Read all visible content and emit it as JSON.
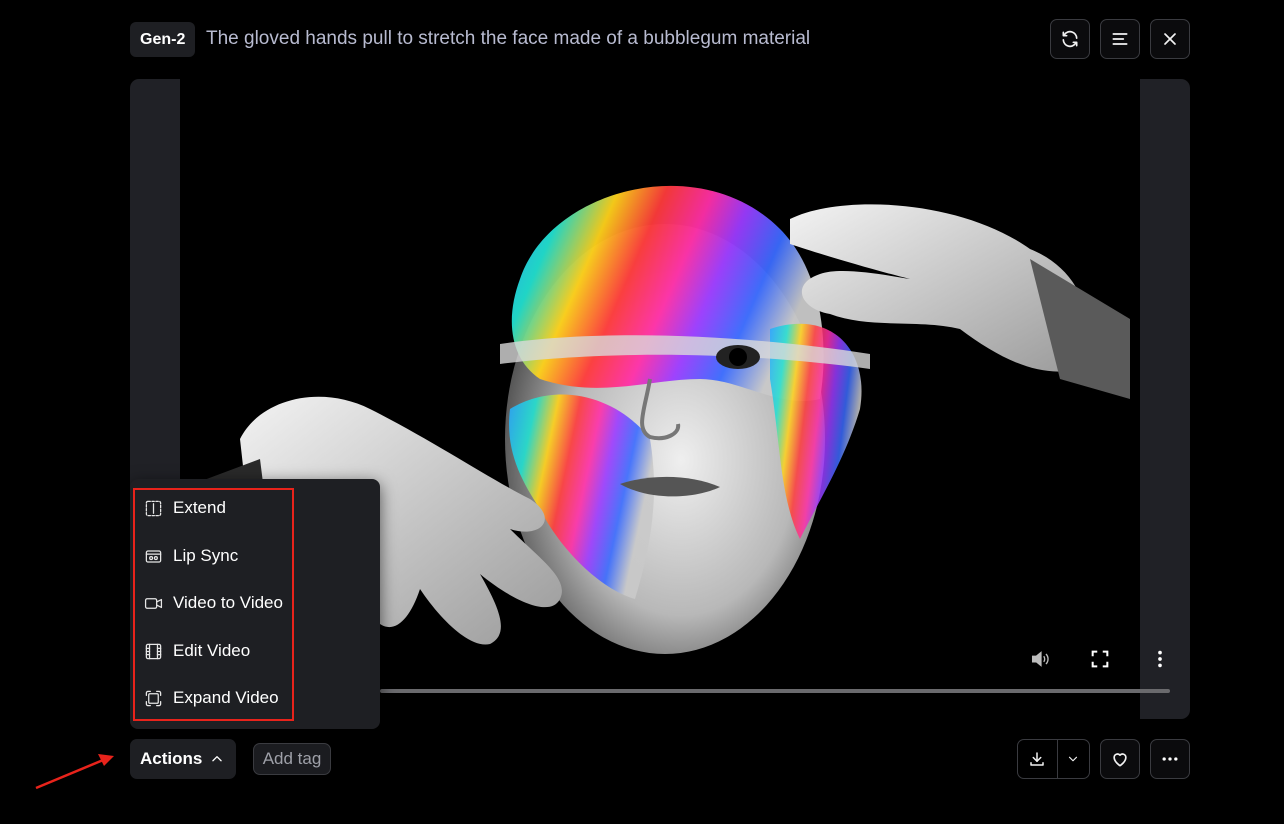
{
  "header": {
    "model_badge": "Gen-2",
    "prompt": "The gloved hands pull to stretch the face made of a bubblegum material",
    "buttons": [
      "refresh-icon",
      "align-left-icon",
      "close-icon"
    ]
  },
  "player": {
    "progress": 0,
    "controls": [
      "volume-icon",
      "fullscreen-icon",
      "more-vertical-icon"
    ]
  },
  "actions_menu": {
    "items": [
      {
        "label": "Extend",
        "icon": "extend-icon"
      },
      {
        "label": "Lip Sync",
        "icon": "lip-sync-icon"
      },
      {
        "label": "Video to Video",
        "icon": "video-camera-icon"
      },
      {
        "label": "Edit Video",
        "icon": "film-icon"
      },
      {
        "label": "Expand Video",
        "icon": "expand-frame-icon"
      }
    ]
  },
  "footer": {
    "actions_label": "Actions",
    "add_tag_label": "Add tag",
    "right_buttons": [
      "download-icon",
      "chevron-down-icon",
      "heart-icon",
      "more-horizontal-icon"
    ]
  },
  "colors": {
    "background": "#000000",
    "panel": "#1e1f23",
    "annotation_red": "#e8231b"
  }
}
